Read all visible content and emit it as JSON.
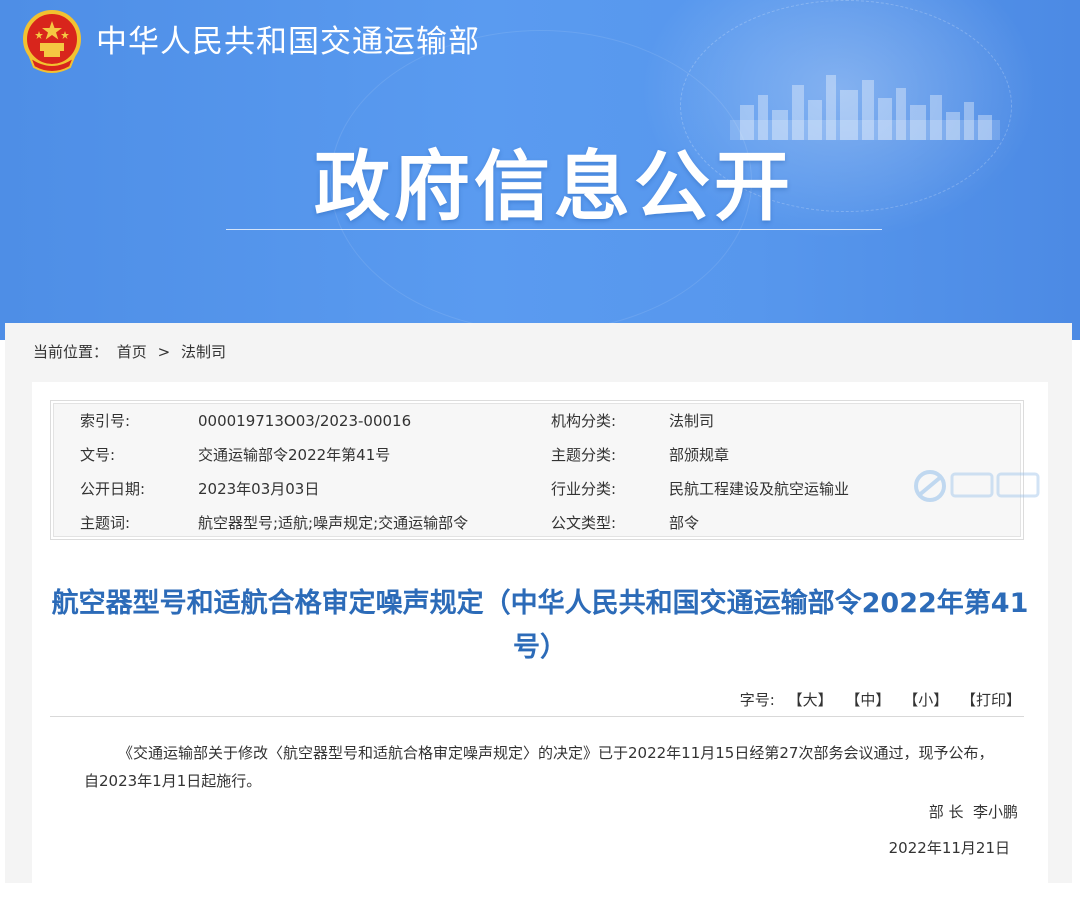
{
  "header": {
    "ministry_name": "中华人民共和国交通运输部",
    "banner_title": "政府信息公开"
  },
  "breadcrumb": {
    "label": "当前位置：",
    "items": [
      "首页",
      "法制司"
    ],
    "separator": ">"
  },
  "meta": {
    "rows": [
      {
        "label1": "索引号:",
        "value1": "000019713O03/2023-00016",
        "label2": "机构分类:",
        "value2": "法制司"
      },
      {
        "label1": "文号:",
        "value1": "交通运输部令2022年第41号",
        "label2": "主题分类:",
        "value2": "部颁规章"
      },
      {
        "label1": "公开日期:",
        "value1": "2023年03月03日",
        "label2": "行业分类:",
        "value2": "民航工程建设及航空运输业"
      },
      {
        "label1": "主题词:",
        "value1": "航空器型号;适航;噪声规定;交通运输部令",
        "label2": "公文类型:",
        "value2": "部令"
      }
    ]
  },
  "document": {
    "title": "航空器型号和适航合格审定噪声规定（中华人民共和国交通运输部令2022年第41号）",
    "body": "《交通运输部关于修改〈航空器型号和适航合格审定噪声规定〉的决定》已于2022年11月15日经第27次部务会议通过，现予公布，自2023年1月1日起施行。",
    "signer": "部 长  李小鹏",
    "date": "2022年11月21日"
  },
  "font_tools": {
    "label": "字号:",
    "large": "【大】",
    "medium": "【中】",
    "small": "【小】",
    "print": "【打印】"
  },
  "colors": {
    "banner": "#5a9bf0",
    "title": "#2c6bb8",
    "page_bg": "#f4f4f4"
  }
}
